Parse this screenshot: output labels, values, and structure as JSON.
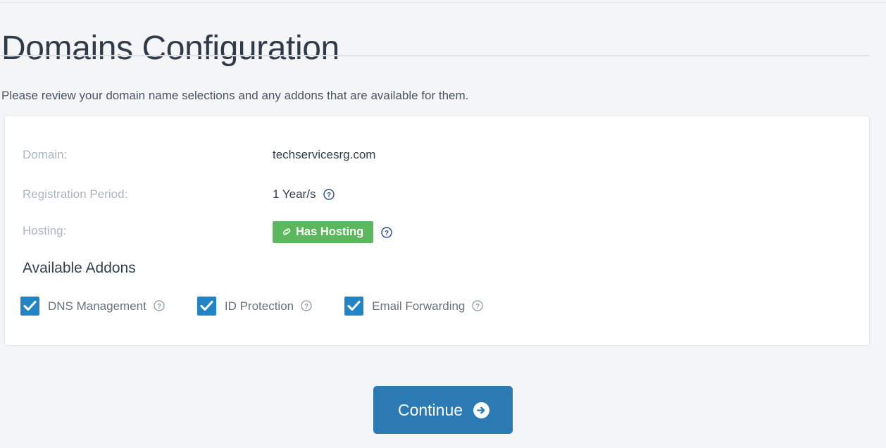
{
  "page": {
    "title": "Domains Configuration",
    "intro": "Please review your domain name selections and any addons that are available for them."
  },
  "domain_card": {
    "rows": [
      {
        "label": "Domain:",
        "value": "techservicesrg.com",
        "help": false
      },
      {
        "label": "Registration Period:",
        "value": "1 Year/s",
        "help": true
      },
      {
        "label": "Hosting:",
        "value": "Has Hosting",
        "help": true,
        "badge": true
      }
    ],
    "addons_heading": "Available Addons",
    "addons": [
      {
        "label": "DNS Management",
        "checked": true
      },
      {
        "label": "ID Protection",
        "checked": true
      },
      {
        "label": "Email Forwarding",
        "checked": true
      }
    ]
  },
  "actions": {
    "continue_label": "Continue"
  },
  "icons": {
    "help": "circle-question-icon",
    "hosting_badge": "link-icon",
    "continue_arrow": "arrow-circle-right-icon",
    "checkbox_check": "check-icon"
  },
  "colors": {
    "page_background": "#f4f5f7",
    "card_background": "#ffffff",
    "card_border": "#e3e5e8",
    "title_text": "#2f3b49",
    "label_text": "#adb5bd",
    "value_text": "#323d4c",
    "badge_green": "#5cb85c",
    "checkbox_blue": "#2184c6",
    "button_blue": "#2b7ab4",
    "help_icon_blue": "#2b4a8b"
  }
}
